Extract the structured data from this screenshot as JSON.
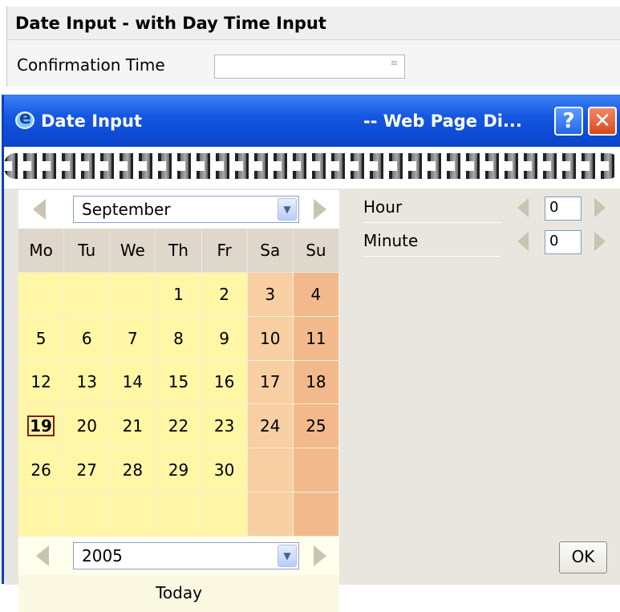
{
  "form": {
    "title": "Date Input - with Day Time Input",
    "confirmation_label": "Confirmation Time",
    "confirmation_value": "",
    "select_glyph": "≡"
  },
  "dialog": {
    "title": "Date Input",
    "title_suffix": "-- Web Page Di...",
    "help_label": "?",
    "close_label": "✕",
    "icon": "ie-icon"
  },
  "calendar": {
    "month": "September",
    "year": "2005",
    "dropdown_glyph": "▼",
    "weekdays": [
      "Mo",
      "Tu",
      "We",
      "Th",
      "Fr",
      "Sa",
      "Su"
    ],
    "weeks": [
      [
        "",
        "",
        "",
        "1",
        "2",
        "3",
        "4"
      ],
      [
        "5",
        "6",
        "7",
        "8",
        "9",
        "10",
        "11"
      ],
      [
        "12",
        "13",
        "14",
        "15",
        "16",
        "17",
        "18"
      ],
      [
        "19",
        "20",
        "21",
        "22",
        "23",
        "24",
        "25"
      ],
      [
        "26",
        "27",
        "28",
        "29",
        "30",
        "",
        ""
      ],
      [
        "",
        "",
        "",
        "",
        "",
        "",
        ""
      ]
    ],
    "selected_day": "19",
    "today_label": "Today"
  },
  "time": {
    "hour_label": "Hour",
    "hour_value": "0",
    "minute_label": "Minute",
    "minute_value": "0"
  },
  "ok_label": "OK",
  "colors": {
    "weekday_cell": "#fff6a6",
    "saturday_cell": "#f7cfa3",
    "sunday_cell": "#f2b98c",
    "header_cell": "#ded7cb",
    "titlebar": "#0c4ad2"
  }
}
